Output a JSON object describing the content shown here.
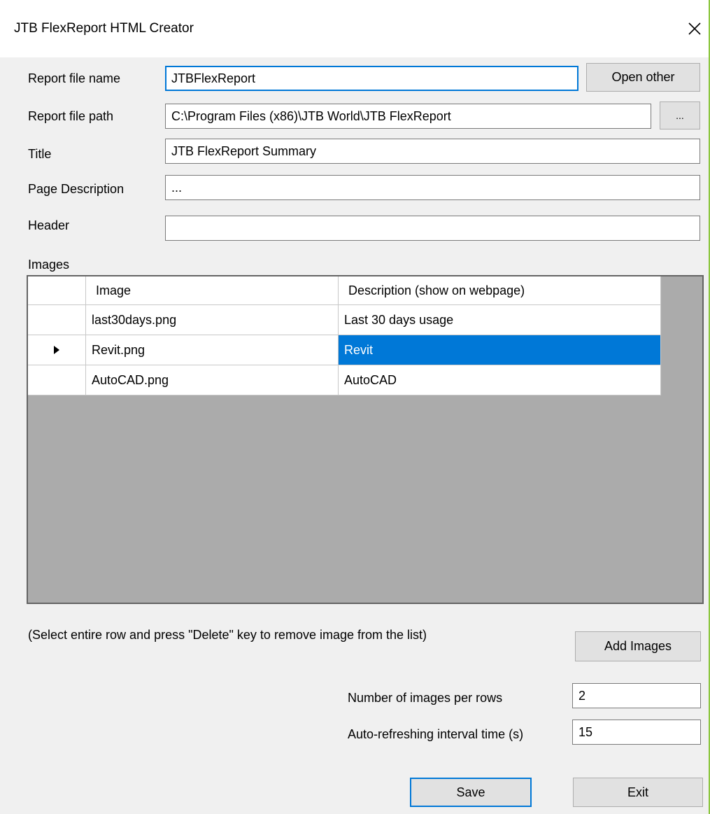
{
  "window": {
    "title": "JTB FlexReport HTML Creator"
  },
  "form": {
    "report_file_name": {
      "label": "Report file name",
      "value": "JTBFlexReport"
    },
    "open_other_label": "Open other",
    "report_file_path": {
      "label": "Report file path",
      "value": "C:\\Program Files (x86)\\JTB World\\JTB FlexReport"
    },
    "browse_label": "...",
    "title": {
      "label": "Title",
      "value": "JTB FlexReport Summary"
    },
    "page_description": {
      "label": "Page Description",
      "value": "..."
    },
    "header": {
      "label": "Header",
      "value": ""
    },
    "images_label": "Images"
  },
  "grid": {
    "columns": [
      "Image",
      "Description (show on webpage)"
    ],
    "rows": [
      {
        "image": "last30days.png",
        "description": "Last 30 days usage"
      },
      {
        "image": "Revit.png",
        "description": "Revit"
      },
      {
        "image": "AutoCAD.png",
        "description": "AutoCAD"
      }
    ],
    "current_row": 1,
    "selected_cell": {
      "row": 1,
      "column": 1
    }
  },
  "hint": "(Select entire row and press \"Delete\" key to remove image from the list)",
  "add_images_label": "Add Images",
  "options": {
    "images_per_row": {
      "label": "Number of images per rows",
      "value": "2"
    },
    "refresh_interval": {
      "label": "Auto-refreshing interval time (s)",
      "value": "15"
    }
  },
  "buttons": {
    "save_label": "Save",
    "exit_label": "Exit"
  },
  "colors": {
    "accent": "#0078d7",
    "window_border": "#8cc63f",
    "grid_background": "#ababab"
  },
  "icons": {
    "close": "close-icon",
    "row_indicator": "row-pointer-icon"
  }
}
